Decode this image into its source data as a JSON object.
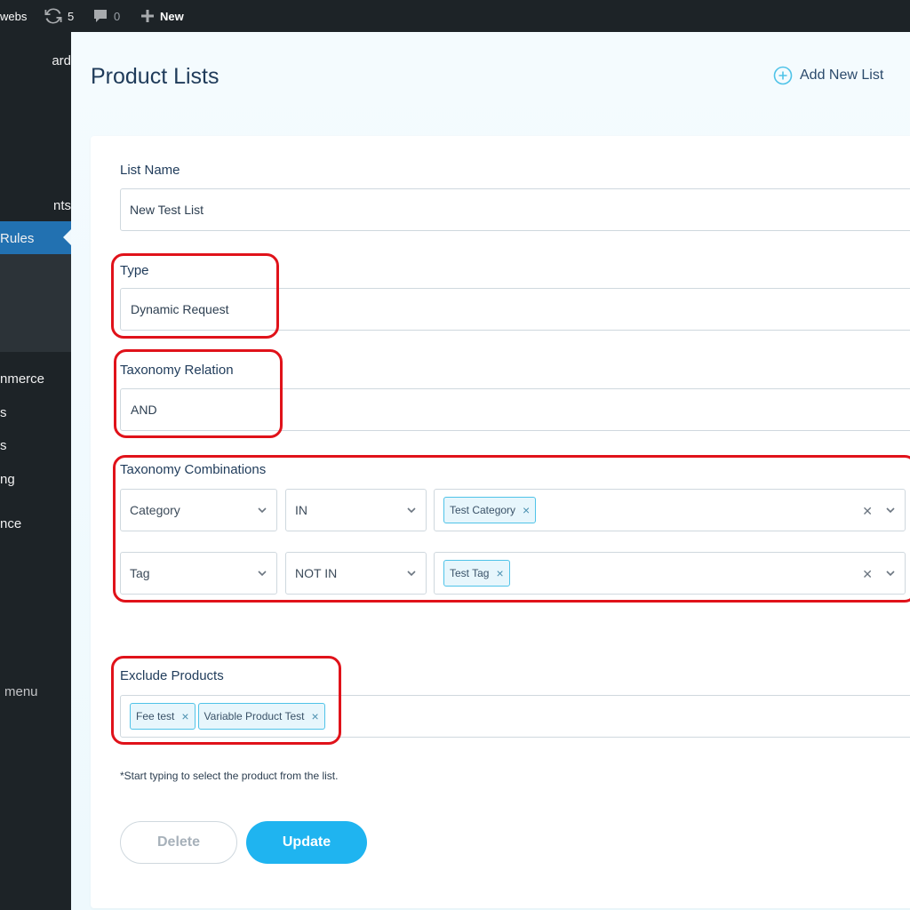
{
  "adminbar": {
    "site": "webs",
    "updates_count": "5",
    "comments_count": "0",
    "new_label": "New"
  },
  "sidebar": {
    "items": [
      {
        "label": "ard"
      },
      {
        "label": "nts"
      },
      {
        "label": "Rules"
      },
      {
        "label": "nmerce"
      },
      {
        "label": "s"
      },
      {
        "label": "s"
      },
      {
        "label": "ng"
      },
      {
        "label": "nce"
      },
      {
        "label": "menu"
      }
    ]
  },
  "page": {
    "title": "Product Lists",
    "add_new_label": "Add New List"
  },
  "form": {
    "list_name_label": "List Name",
    "list_name_value": "New Test List",
    "type_label": "Type",
    "type_value": "Dynamic Request",
    "taxonomy_relation_label": "Taxonomy Relation",
    "taxonomy_relation_value": "AND",
    "taxonomy_combinations_label": "Taxonomy Combinations",
    "combinations": [
      {
        "taxonomy": "Category",
        "operator": "IN",
        "terms": [
          "Test Category"
        ]
      },
      {
        "taxonomy": "Tag",
        "operator": "NOT IN",
        "terms": [
          "Test Tag"
        ]
      }
    ],
    "exclude_products_label": "Exclude Products",
    "exclude_products": [
      "Fee test",
      "Variable Product Test"
    ],
    "hint": "*Start typing to select the product from the list.",
    "delete_label": "Delete",
    "update_label": "Update"
  },
  "colors": {
    "accent": "#1fb4f0",
    "highlight": "#e0121a",
    "admin_dark": "#1d2327",
    "active_menu": "#2271b1"
  }
}
